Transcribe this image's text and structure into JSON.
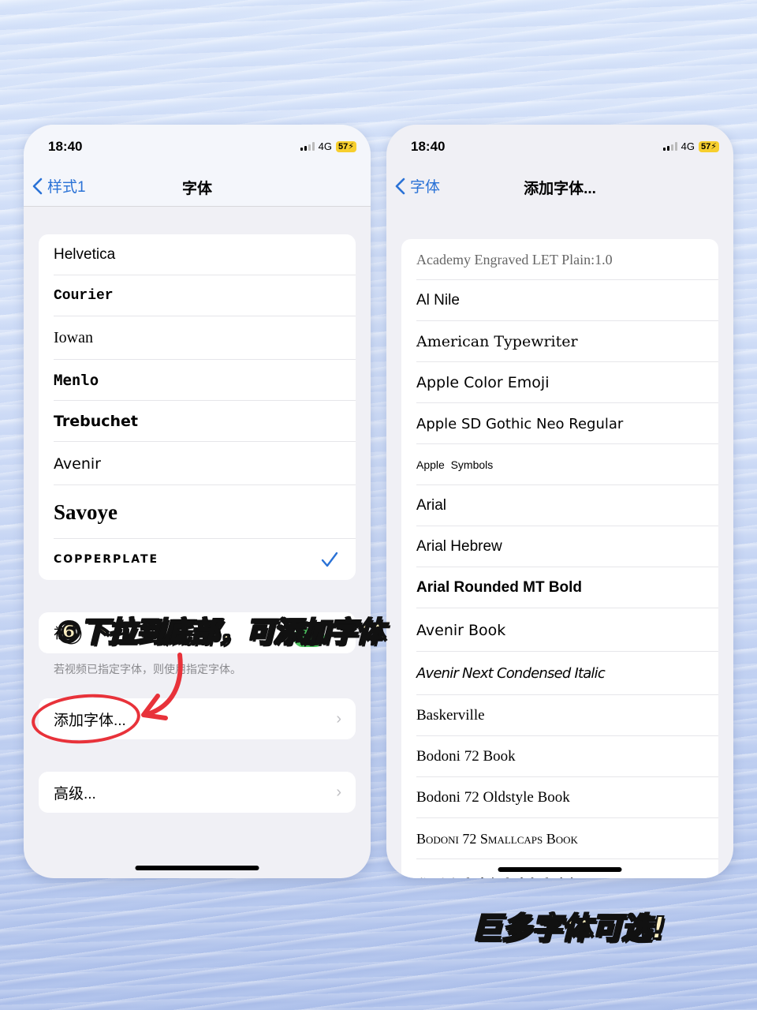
{
  "left_screen": {
    "status": {
      "time": "18:40",
      "network": "4G",
      "battery": "57"
    },
    "nav": {
      "back_label": "样式1",
      "title": "字体"
    },
    "fonts": [
      {
        "name": "Helvetica",
        "selected": false
      },
      {
        "name": "Courier",
        "selected": false
      },
      {
        "name": "Iowan",
        "selected": false
      },
      {
        "name": "Menlo",
        "selected": false
      },
      {
        "name": "Trebuchet",
        "selected": false
      },
      {
        "name": "Avenir",
        "selected": false
      },
      {
        "name": "Savoye",
        "selected": false
      },
      {
        "name": "Copperplate",
        "selected": true
      }
    ],
    "hidden_row_label": "初",
    "footnote": "若视频已指定字体，则使用指定字体。",
    "add_font_label": "添加字体...",
    "advanced_label": "高级..."
  },
  "right_screen": {
    "status": {
      "time": "18:40",
      "network": "4G",
      "battery": "57"
    },
    "nav": {
      "back_label": "字体",
      "title": "添加字体..."
    },
    "fonts": [
      "Academy Engraved LET Plain:1.0",
      "Al Nile",
      "American Typewriter",
      "Apple Color Emoji",
      "Apple SD Gothic Neo Regular",
      "Apple  Symbols",
      "Arial",
      "Arial Hebrew",
      "Arial Rounded MT Bold",
      "Avenir Book",
      "Avenir Next Condensed Italic",
      "Baskerville",
      "Bodoni 72 Book",
      "Bodoni 72 Oldstyle Book",
      "Bodoni 72 Smallcaps Book",
      "❦❧✿❀ ♧ ✽❋ ♧ ✾❁ ♧ ✻✼"
    ]
  },
  "annotations": {
    "step_caption": "⑥下拉到底部，可添加字体",
    "bottom_caption": "巨多字体可选!",
    "accent_red": "#e8323a",
    "caption_fill": "#fbeec0",
    "ios_blue": "#2a72d6"
  }
}
